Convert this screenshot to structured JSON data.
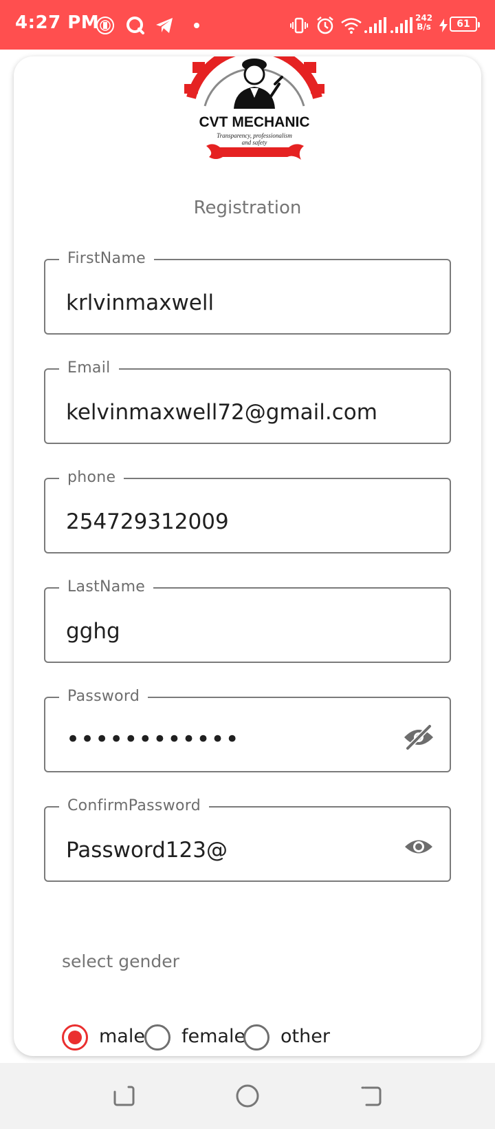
{
  "status_bar": {
    "time": "4:27 PM",
    "net_speed_value": "242",
    "net_speed_unit": "B/s",
    "battery": "61",
    "accent_color": "#ff4f4f"
  },
  "logo": {
    "title": "CVT MECHANIC",
    "tagline_line1": "Transparency, professionalism",
    "tagline_line2": "and safety"
  },
  "page_title": "Registration",
  "form": {
    "first_name": {
      "label": "FirstName",
      "value": "krlvinmaxwell"
    },
    "email": {
      "label": "Email",
      "value": "kelvinmaxwell72@gmail.com"
    },
    "phone": {
      "label": "phone",
      "value": "254729312009"
    },
    "last_name": {
      "label": "LastName",
      "value": "gghg"
    },
    "password": {
      "label": "Password",
      "value": "••••••••••••",
      "visibility_icon": "eye-off-icon"
    },
    "confirm_password": {
      "label": "ConfirmPassword",
      "value": "Password123@",
      "visibility_icon": "eye-icon"
    }
  },
  "gender": {
    "label": "select gender",
    "options": [
      {
        "label": "male",
        "selected": true
      },
      {
        "label": "female",
        "selected": false
      },
      {
        "label": "other",
        "selected": false
      }
    ],
    "selected_color": "#ea2f2f"
  },
  "nav_bar": {
    "buttons": [
      "recent-apps-icon",
      "home-icon",
      "back-icon"
    ]
  }
}
